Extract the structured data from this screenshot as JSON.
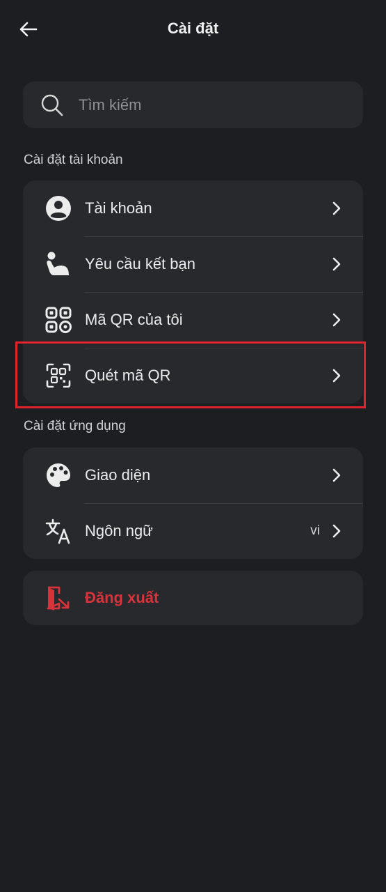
{
  "header": {
    "title": "Cài đặt",
    "back_icon": "arrow-left-icon"
  },
  "search": {
    "placeholder": "Tìm kiếm",
    "value": "",
    "icon": "search-icon"
  },
  "account_section": {
    "label": "Cài đặt tài khoản",
    "items": [
      {
        "label": "Tài khoản",
        "icon": "user-circle-icon"
      },
      {
        "label": "Yêu cầu kết bạn",
        "icon": "friend-request-icon"
      },
      {
        "label": "Mã QR của tôi",
        "icon": "qr-code-icon"
      },
      {
        "label": "Quét mã QR",
        "icon": "qr-scan-icon",
        "highlighted": true
      }
    ]
  },
  "app_section": {
    "label": "Cài đặt ứng dụng",
    "items": [
      {
        "label": "Giao diện",
        "icon": "palette-icon"
      },
      {
        "label": "Ngôn ngữ",
        "icon": "translate-icon",
        "value": "vi"
      }
    ]
  },
  "logout": {
    "label": "Đăng xuất",
    "icon": "logout-icon"
  },
  "colors": {
    "background": "#1d1e22",
    "card": "#28292d",
    "danger": "#d8333a",
    "highlight_border": "#e0242c"
  }
}
